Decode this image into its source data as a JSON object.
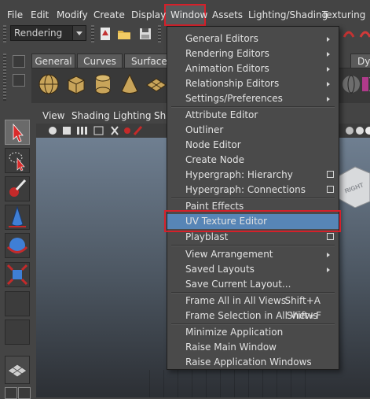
{
  "menubar": {
    "items": [
      "File",
      "Edit",
      "Modify",
      "Create",
      "Display",
      "Window",
      "Assets",
      "Lighting/Shading",
      "Texturing"
    ]
  },
  "statusline": {
    "menu_set": "Rendering"
  },
  "shelf": {
    "tabs": [
      "General",
      "Curves",
      "Surfaces",
      "Dyn"
    ]
  },
  "panel_menu": {
    "items": [
      "View",
      "Shading",
      "Lighting",
      "Sho"
    ]
  },
  "viewcube": {
    "face_label": "RIGHT"
  },
  "window_menu": {
    "items": [
      {
        "label": "General Editors",
        "submenu": true
      },
      {
        "label": "Rendering Editors",
        "submenu": true
      },
      {
        "label": "Animation Editors",
        "submenu": true
      },
      {
        "label": "Relationship Editors",
        "submenu": true
      },
      {
        "label": "Settings/Preferences",
        "submenu": true
      },
      {
        "label": "Attribute Editor"
      },
      {
        "label": "Outliner"
      },
      {
        "label": "Node Editor"
      },
      {
        "label": "Create Node"
      },
      {
        "label": "Hypergraph: Hierarchy",
        "option_box": true
      },
      {
        "label": "Hypergraph: Connections",
        "option_box": true
      },
      {
        "label": "Paint Effects"
      },
      {
        "label": "UV Texture Editor",
        "highlighted": true
      },
      {
        "label": "Playblast",
        "option_box": true
      },
      {
        "label": "View Arrangement",
        "submenu": true
      },
      {
        "label": "Saved Layouts",
        "submenu": true
      },
      {
        "label": "Save Current Layout..."
      },
      {
        "label": "Frame All in All Views",
        "shortcut": "Shift+A"
      },
      {
        "label": "Frame Selection in All Views",
        "shortcut": "Shift+F"
      },
      {
        "label": "Minimize Application"
      },
      {
        "label": "Raise Main Window"
      },
      {
        "label": "Raise Application Windows"
      }
    ]
  },
  "colors": {
    "highlight": "#5785b6",
    "annotation_red": "#d5202a"
  }
}
